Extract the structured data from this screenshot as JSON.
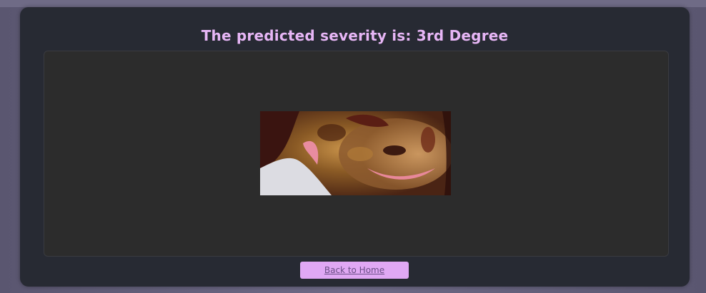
{
  "result": {
    "title": "The predicted severity is: 3rd Degree"
  },
  "image": {
    "alt": "Uploaded burn image"
  },
  "actions": {
    "back_label": "Back to Home"
  }
}
